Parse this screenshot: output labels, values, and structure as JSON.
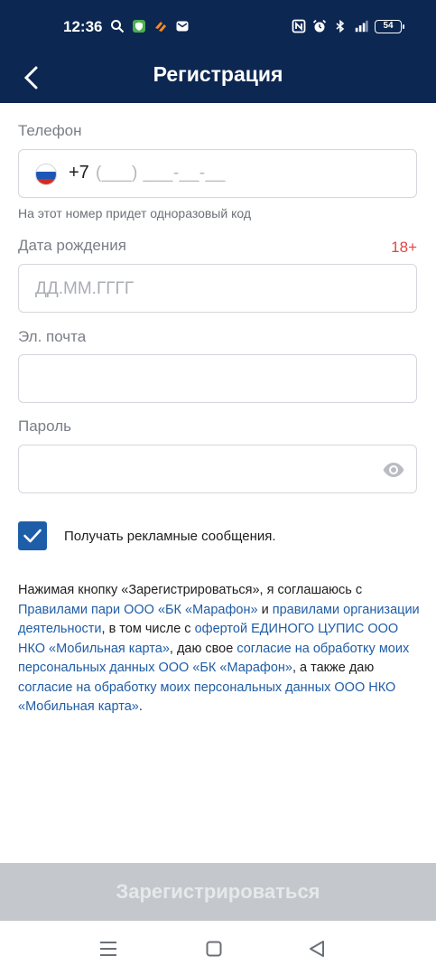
{
  "status_bar": {
    "time": "12:36",
    "battery": "54",
    "bg_color": "#0c2751"
  },
  "app_bar": {
    "title": "Регистрация",
    "back_icon": "chevron-left-icon"
  },
  "form": {
    "phone": {
      "label": "Телефон",
      "country_flag": "russia-flag-icon",
      "prefix": "+7",
      "mask": "(___) ___-__-__",
      "hint": "На этот номер придет одноразовый код"
    },
    "birth_date": {
      "label": "Дата рождения",
      "age_badge": "18+",
      "placeholder": "ДД.ММ.ГГГГ"
    },
    "email": {
      "label": "Эл. почта",
      "value": ""
    },
    "password": {
      "label": "Пароль",
      "value": "",
      "toggle_icon": "eye-icon"
    },
    "promo_checkbox": {
      "checked": true,
      "label": "Получать рекламные сообщения."
    }
  },
  "terms": {
    "t1": "Нажимая кнопку «Зарегистрироваться», я соглашаюсь с ",
    "link1": "Правилами пари ООО «БК «Марафон»",
    "t2": " и ",
    "link2": "правилами организации деятельности",
    "t3": ", в том числе с ",
    "link3": "офертой ЕДИНОГО ЦУПИС ООО НКО «Мобильная карта»",
    "t4": ", даю свое ",
    "link4": "согласие на обработку моих персональных данных ООО «БК «Марафон»",
    "t5": ", а также даю ",
    "link5": "согласие на обработку моих персональных данных ООО НКО «Мобильная карта»",
    "t6": "."
  },
  "register_button": {
    "label": "Зарегистрироваться",
    "enabled": false
  },
  "colors": {
    "accent": "#1e5ea9",
    "link": "#1f5da6",
    "age_badge": "#e24545",
    "disabled_button": "#c4c7cc"
  }
}
